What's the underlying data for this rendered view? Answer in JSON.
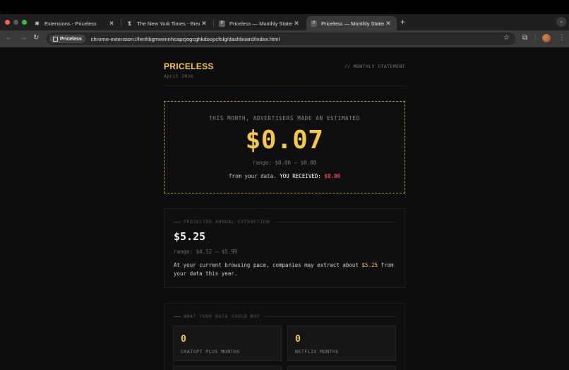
{
  "browser": {
    "tabs": [
      {
        "title": "Extensions - Priceless",
        "icon": "puzzle-icon",
        "active": false
      },
      {
        "title": "The New York Times - Breaki",
        "icon": "nyt-icon",
        "active": false
      },
      {
        "title": "Priceless — Monthly Stateme",
        "icon": "priceless-icon",
        "active": false
      },
      {
        "title": "Priceless — Monthly Stateme",
        "icon": "priceless-icon",
        "active": true
      }
    ],
    "new_tab": "+",
    "site_chip": "Priceless",
    "url": "chrome-extension://fenhbgmeennhcapcjogcghkdoopcfolg/dashboard/index.html"
  },
  "header": {
    "brand": "PRICELESS",
    "month": "April 2026",
    "tagline": "// MONTHLY STATEMENT"
  },
  "hero": {
    "label": "THIS MONTH, ADVERTISERS MADE AN ESTIMATED",
    "amount": "$0.07",
    "range": "range: $0.06 – $0.08",
    "received_prefix": "from your data. ",
    "received_label": "YOU RECEIVED:",
    "received_value": "$0.00",
    "accent_color": "#f5c842",
    "received_color": "#e24b4b"
  },
  "annual": {
    "title": "PROJECTED ANNUAL EXTRACTION",
    "amount": "$5.25",
    "range": "range: $4.52 – $5.99",
    "text_prefix": "At your current browsing pace, companies may extract about ",
    "text_highlight": "$5.25",
    "text_suffix": " from your data this year."
  },
  "buy": {
    "title": "WHAT YOUR DATA COULD BUY",
    "items": [
      {
        "value": "0",
        "label": "CHATGPT PLUS MONTHS"
      },
      {
        "value": "0",
        "label": "NETFLIX MONTHS"
      }
    ]
  }
}
